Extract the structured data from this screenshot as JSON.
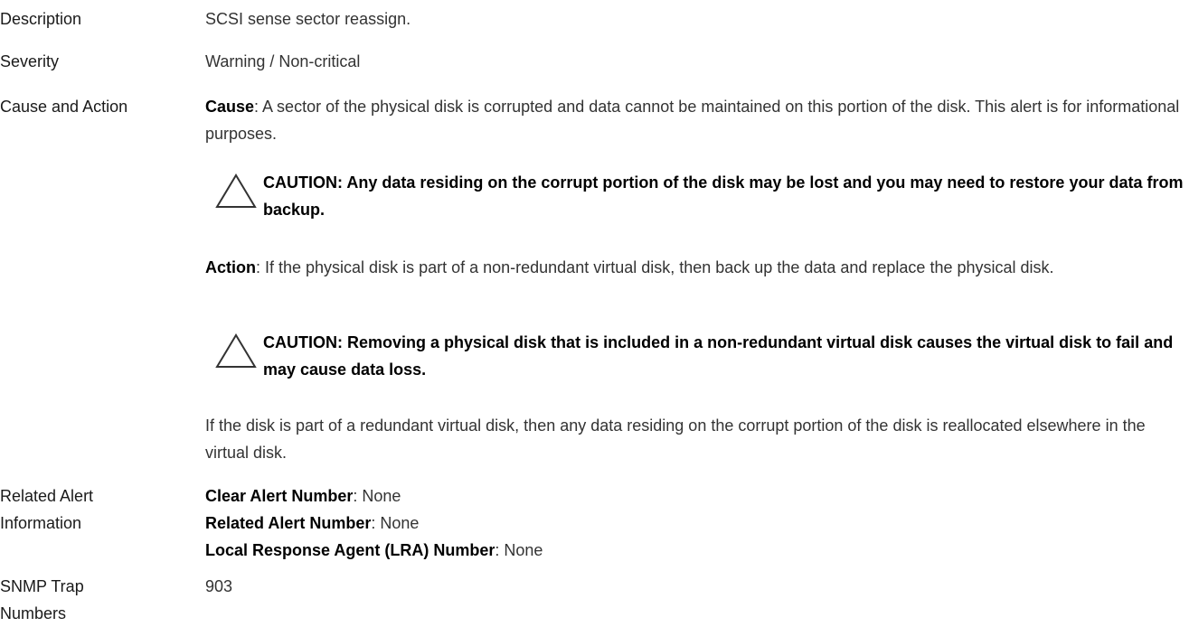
{
  "rows": {
    "description": {
      "label": "Description",
      "value": "SCSI sense sector reassign."
    },
    "severity": {
      "label": "Severity",
      "value": "Warning / Non-critical"
    },
    "cause_action": {
      "label": "Cause and Action",
      "cause_lead": "Cause",
      "cause_text": ": A sector of the physical disk is corrupted and data cannot be maintained on this portion of the disk. This alert is for informational purposes.",
      "caution1": "CAUTION: Any data residing on the corrupt portion of the disk may be lost and you may need to restore your data from backup.",
      "action_lead": "Action",
      "action_text": ": If the physical disk is part of a non-redundant virtual disk, then back up the data and replace the physical disk.",
      "caution2": "CAUTION: Removing a physical disk that is included in a non-redundant virtual disk causes the virtual disk to fail and may cause data loss.",
      "redundant_text": "If the disk is part of a redundant virtual disk, then any data residing on the corrupt portion of the disk is reallocated elsewhere in the virtual disk."
    },
    "related": {
      "label_line1": "Related Alert",
      "label_line2": "Information",
      "clear_lead": "Clear Alert Number",
      "clear_value": ": None",
      "related_lead": "Related Alert Number",
      "related_value": ": None",
      "lra_lead": "Local Response Agent (LRA) Number",
      "lra_value": ": None"
    },
    "snmp": {
      "label_line1": "SNMP Trap",
      "label_line2": "Numbers",
      "value": "903"
    }
  },
  "icons": {
    "caution": "warning-triangle-icon"
  }
}
